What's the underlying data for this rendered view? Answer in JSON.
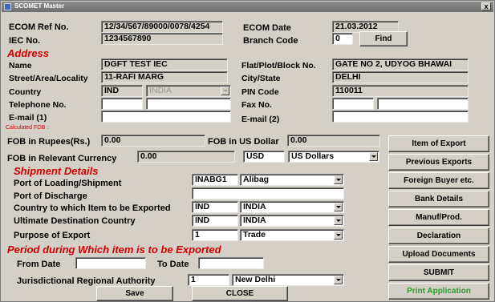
{
  "window": {
    "title": "SCOMET Master",
    "close_glyph": "x"
  },
  "ecom": {
    "ref_label": "ECOM Ref No.",
    "ref_value": "12/34/567/89000/0078/4254",
    "date_label": "ECOM Date",
    "date_value": "21.03.2012",
    "iec_label": "IEC No.",
    "iec_value": "1234567890",
    "branch_label": "Branch Code",
    "branch_value": "0",
    "find_label": "Find"
  },
  "address": {
    "heading": "Address",
    "name_label": "Name",
    "name_value": "DGFT TEST IEC",
    "flat_label": "Flat/Plot/Block No.",
    "flat_value": "GATE NO 2, UDYOG BHAWAI",
    "street_label": "Street/Area/Locality",
    "street_value": "11-RAFI MARG",
    "city_label": "City/State",
    "city_value": "DELHI",
    "country_label": "Country",
    "country_code": "IND",
    "country_name": "INDIA",
    "pin_label": "PIN Code",
    "pin_value": "110011",
    "tel_label": "Telephone No.",
    "tel_value_1": "",
    "tel_value_2": "",
    "fax_label": "Fax No.",
    "fax_value_1": "",
    "fax_value_2": "",
    "email1_label": "E-mail (1)",
    "email1_value": "",
    "email2_label": "E-mail (2)",
    "email2_value": ""
  },
  "fob": {
    "calc_label": "Calculated FOB :",
    "rs_label": "FOB in Rupees(Rs.)",
    "rs_value": "0.00",
    "usd_label": "FOB in US Dollar",
    "usd_value": "0.00",
    "rel_label": "FOB in Relevant Currency",
    "rel_value": "0.00",
    "currency_code": "USD",
    "currency_name": "US Dollars"
  },
  "shipment": {
    "heading": "Shipment Details",
    "loading_label": "Port of Loading/Shipment",
    "loading_code": "INABG1",
    "loading_name": "Alibag",
    "discharge_label": "Port of Discharge",
    "discharge_value": "",
    "country_export_label": "Country to which Item to be Exported",
    "country_export_code": "IND",
    "country_export_name": "INDIA",
    "dest_label": "Ultimate Destination Country",
    "dest_code": "IND",
    "dest_name": "INDIA",
    "purpose_label": "Purpose of Export",
    "purpose_code": "1",
    "purpose_name": "Trade"
  },
  "period": {
    "heading": "Period during Which item is to be Exported",
    "from_label": "From Date",
    "from_value": "",
    "to_label": "To Date",
    "to_value": "",
    "jra_label": "Jurisdictional Regional Authority",
    "jra_code": "1",
    "jra_name": "New Delhi"
  },
  "buttons": {
    "save": "Save",
    "close": "CLOSE"
  },
  "side_buttons": {
    "item_of_export": "Item of Export",
    "previous_exports": "Previous Exports",
    "foreign_buyer": "Foreign Buyer etc.",
    "bank_details": "Bank Details",
    "manuf_prod": "Manuf/Prod.",
    "declaration": "Declaration",
    "upload_documents": "Upload Documents",
    "submit": "SUBMIT",
    "print_application": "Print Application"
  },
  "colors": {
    "window_bg": "#d4d0c8",
    "section_heading": "#d00000",
    "print_button_text": "#2a9a2a",
    "titlebar": "#7a7a7a"
  },
  "icons": {
    "window_icon": "app-icon",
    "close_icon": "close-icon",
    "dropdown_icon": "chevron-down-icon"
  }
}
